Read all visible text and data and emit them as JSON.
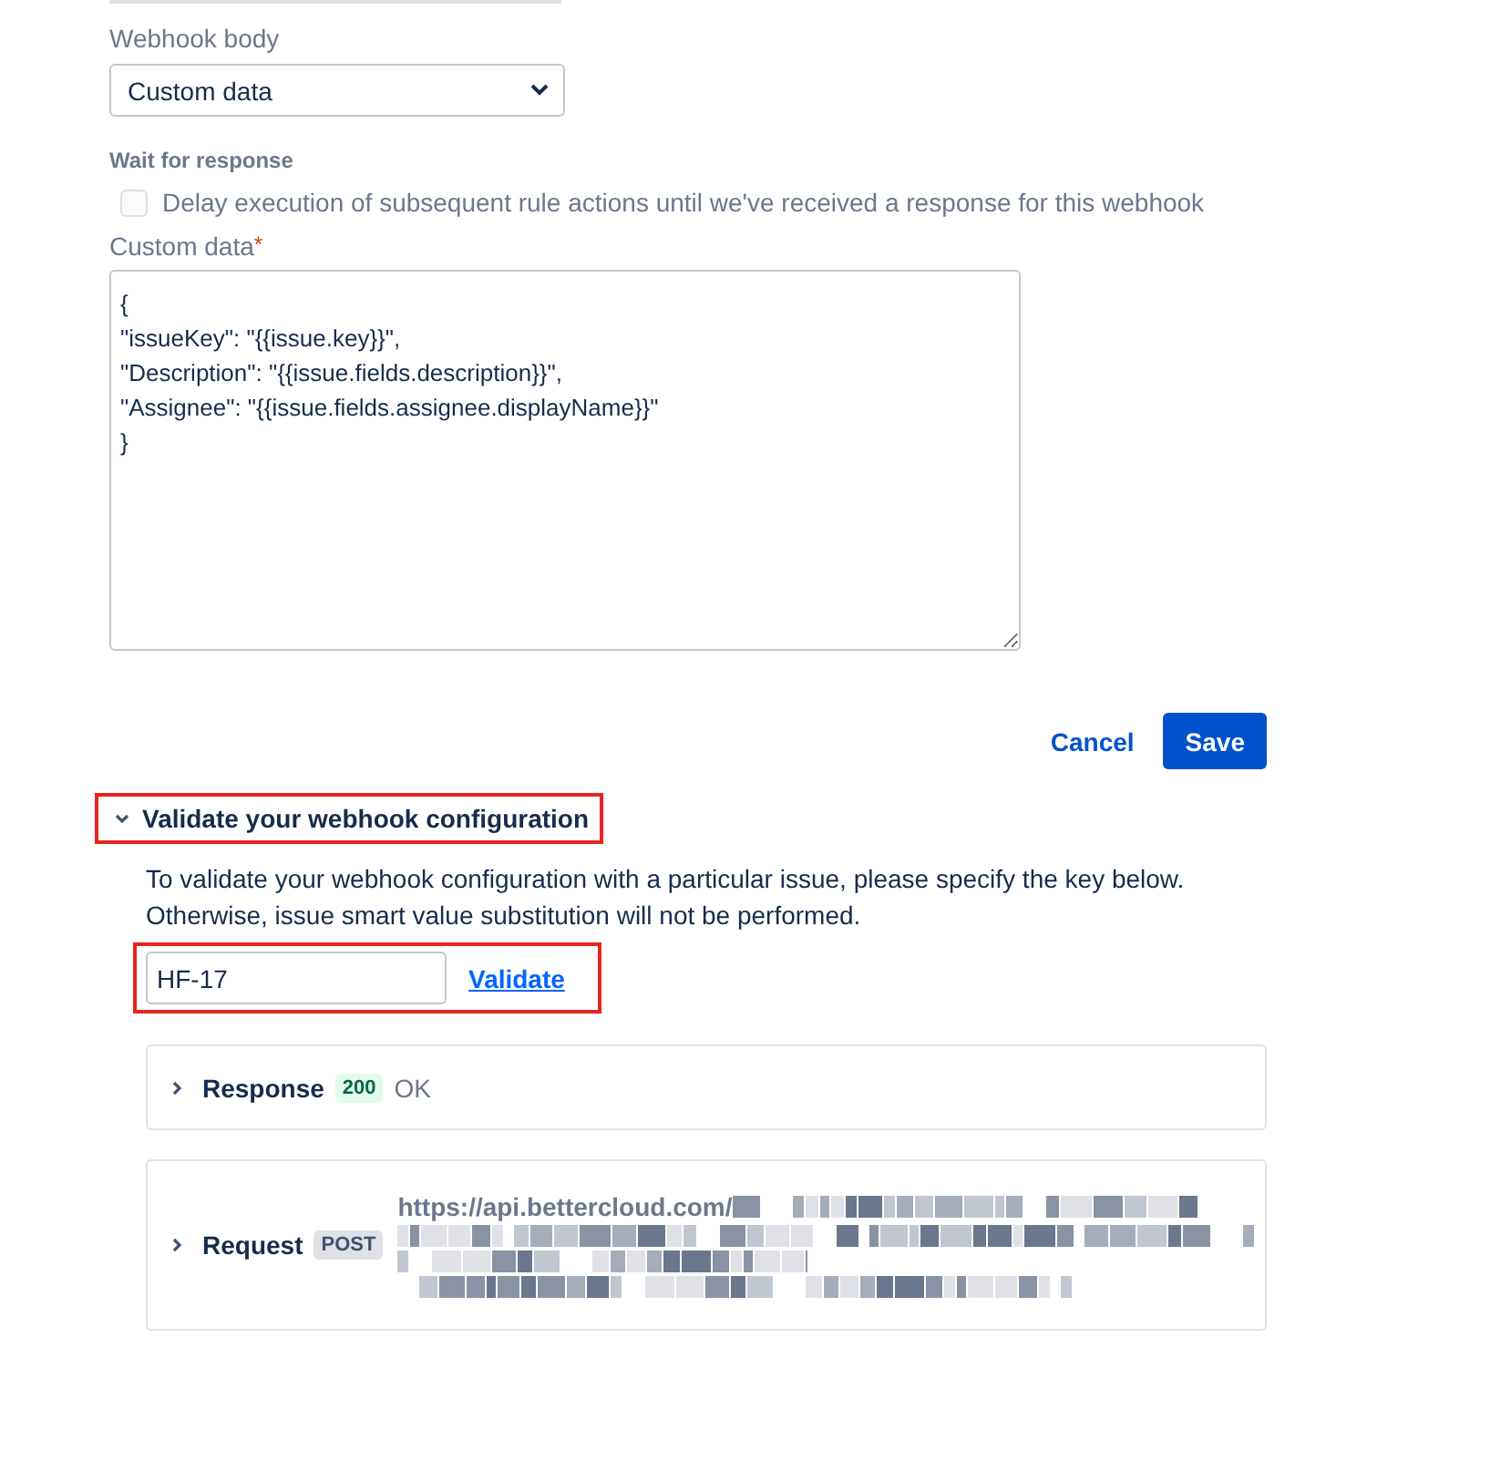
{
  "webhook_body": {
    "label": "Webhook body",
    "value": "Custom data"
  },
  "wait_for_response": {
    "heading": "Wait for response",
    "checkbox_label": "Delay execution of subsequent rule actions until we've received a response for this webhook",
    "checked": false
  },
  "custom_data": {
    "label": "Custom data",
    "required_mark": "*",
    "value": "{\n\"issueKey\": \"{{issue.key}}\",\n\"Description\": \"{{issue.fields.description}}\",\n\"Assignee\": \"{{issue.fields.assignee.displayName}}\"\n}"
  },
  "actions": [
    {
      "label": "Cancel",
      "kind": "link"
    },
    {
      "label": "Save",
      "kind": "primary"
    }
  ],
  "validate": {
    "title": "Validate your webhook configuration",
    "expanded": true,
    "highlighted": true,
    "description": "To validate your webhook configuration with a particular issue, please specify the key below. Otherwise, issue smart value substitution will not be performed.",
    "issue_key": "HF-17",
    "input_highlighted": true,
    "button": "Validate"
  },
  "response": {
    "label": "Response",
    "expanded": false,
    "status_code": "200",
    "status_text": "OK"
  },
  "request": {
    "label": "Request",
    "expanded": false,
    "method": "POST",
    "url": "https://api.bettercloud.com/"
  }
}
